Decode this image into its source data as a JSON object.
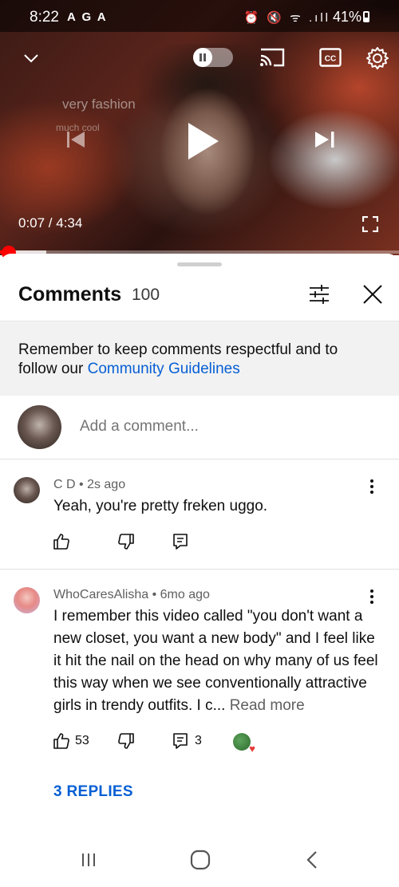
{
  "status_bar": {
    "time": "8:22",
    "left_icons": "A G A",
    "right_icons": "⏰ 🔇 ᯤ .ıll",
    "battery": "41%"
  },
  "video": {
    "overlay_text_1": "very fashion",
    "overlay_text_2": "much cool",
    "current_time": "0:07 / 4:34",
    "progress_fraction": 0.026,
    "buffer_fraction": 0.115,
    "accent": "#ff0000"
  },
  "comments_sheet": {
    "title": "Comments",
    "count": "100",
    "notice_text": "Remember to keep comments respectful and to follow our ",
    "notice_link": "Community Guidelines",
    "add_placeholder": "Add a comment...",
    "comments": [
      {
        "author": "C D",
        "age": "2s ago",
        "text": "Yeah,  you're pretty freken uggo.",
        "likes": "",
        "replies_count": ""
      },
      {
        "author": "WhoCaresAlisha",
        "age": "6mo ago",
        "text": "I remember this video called \"you don't want a new closet, you want a new body\" and I feel like it hit the nail on the head on why many of us feel this way when we see conventionally attractive girls in trendy outfits. I c... ",
        "read_more": "Read more",
        "likes": "53",
        "replies_count": "3",
        "replies_link": "3 REPLIES",
        "creator_hearted": true
      }
    ],
    "link_color": "#065fd4"
  },
  "nav": {
    "recent_icon": "recent-apps-icon",
    "home_icon": "home-icon",
    "back_icon": "back-icon"
  }
}
